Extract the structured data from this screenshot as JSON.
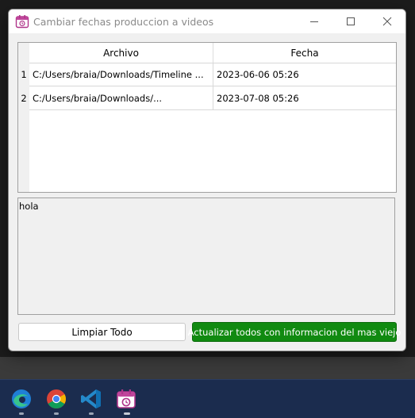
{
  "window": {
    "title": "Cambiar fechas produccion a videos"
  },
  "table": {
    "columns": [
      "Archivo",
      "Fecha"
    ],
    "rows": [
      {
        "num": "1",
        "archivo": "C:/Users/braia/Downloads/Timeline ...",
        "fecha": "2023-06-06 05:26"
      },
      {
        "num": "2",
        "archivo": "C:/Users/braia/Downloads/...",
        "fecha": "2023-07-08 05:26"
      }
    ]
  },
  "log": {
    "text": "hola"
  },
  "buttons": {
    "clear_label": "Limpiar Todo",
    "update_label": "Actualizar todos con informacion del mas viejo"
  },
  "colors": {
    "update_button_bg": "#108a10",
    "taskbar_bg": "#1b2c4e"
  },
  "taskbar": {
    "apps": [
      "edge-icon",
      "chrome-icon",
      "vscode-icon",
      "calendar-app-icon"
    ]
  }
}
